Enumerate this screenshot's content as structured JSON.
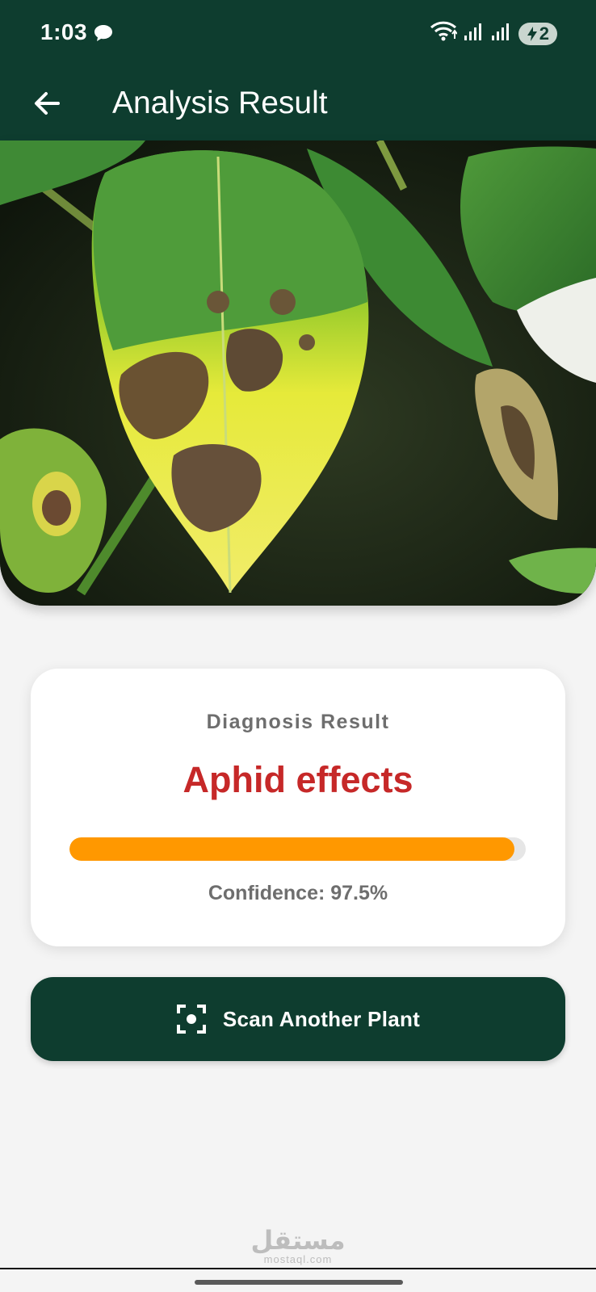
{
  "status_bar": {
    "time": "1:03",
    "battery_level": "2",
    "icons": [
      "chat-bubble-icon",
      "wifi-icon",
      "signal-icon",
      "signal-icon",
      "battery-charging-icon"
    ]
  },
  "app_bar": {
    "back_icon": "arrow-left-icon",
    "title": "Analysis Result"
  },
  "result_card": {
    "label": "Diagnosis Result",
    "diagnosis": "Aphid effects",
    "confidence_text": "Confidence: 97.5%",
    "confidence_value": 0.975
  },
  "scan_button": {
    "icon": "scan-focus-icon",
    "label": "Scan Another Plant"
  },
  "watermark": {
    "arabic": "مستقل",
    "latin": "mostaql.com"
  },
  "colors": {
    "primary": "#0e3d2f",
    "diagnosis": "#c62828",
    "progress": "#ff9800",
    "background": "#f4f4f4"
  }
}
